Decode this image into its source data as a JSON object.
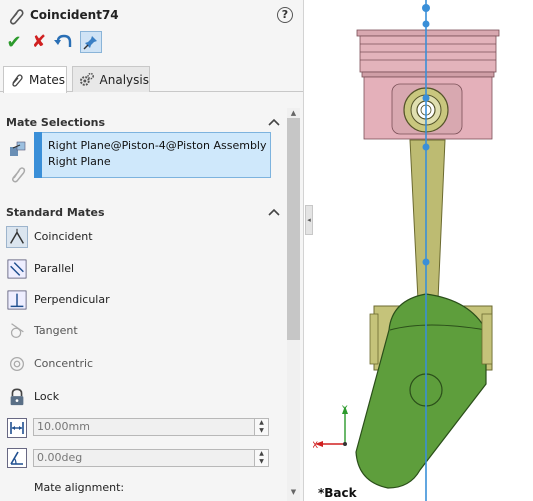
{
  "header": {
    "title": "Coincident74",
    "help_glyph": "?"
  },
  "actions": {
    "ok_glyph": "✔",
    "cancel_glyph": "✘"
  },
  "tabs": [
    {
      "label": "Mates",
      "icon": "paperclip-icon"
    },
    {
      "label": "Analysis",
      "icon": "gears-icon"
    }
  ],
  "mate_selections": {
    "heading": "Mate Selections",
    "items": [
      "Right Plane@Piston-4@Piston Assembly",
      "Right Plane"
    ]
  },
  "standard_mates": {
    "heading": "Standard Mates",
    "items": [
      {
        "label": "Coincident",
        "icon": "coincident-icon",
        "active": true
      },
      {
        "label": "Parallel",
        "icon": "parallel-icon"
      },
      {
        "label": "Perpendicular",
        "icon": "perpendicular-icon"
      },
      {
        "label": "Tangent",
        "icon": "tangent-icon",
        "disabled": true
      },
      {
        "label": "Concentric",
        "icon": "concentric-icon",
        "disabled": true
      },
      {
        "label": "Lock",
        "icon": "lock-icon"
      }
    ],
    "distance_value": "10.00mm",
    "angle_value": "0.00deg",
    "alignment_label": "Mate alignment:"
  },
  "graphics": {
    "view_name": "*Back",
    "axis_y": "Y",
    "axis_x": "X"
  },
  "colors": {
    "piston_top": "#d8a8b0",
    "piston_body": "#e0aab4",
    "rod": "#b5b36a",
    "crank": "#5a9e3a",
    "plane_line": "#3a8fd8"
  }
}
